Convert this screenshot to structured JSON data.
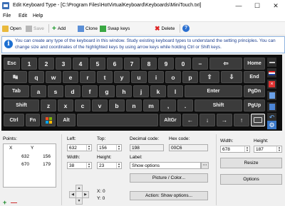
{
  "window": {
    "title": "Edit Keyboard Type - [C:\\Program Files\\HotVirtualKeyboard\\Keyboards\\MiniTouch.txt]"
  },
  "menu": [
    {
      "label": "File"
    },
    {
      "label": "Edit"
    },
    {
      "label": "Help"
    }
  ],
  "toolbar": {
    "open": "Open",
    "save": "Save",
    "add": "Add",
    "clone": "Clone",
    "swap": "Swap keys",
    "delete": "Delete"
  },
  "info": {
    "text": "You can create any type of the keyboard in this window. Study existing keyboard types to understand the setting principles. You can change size and coordinates of the highlighted keys by using arrow keys while holding Ctrl or Shift keys."
  },
  "keyboard": {
    "row1": [
      "Esc",
      "1",
      "2",
      "3",
      "4",
      "5",
      "6",
      "7",
      "8",
      "9",
      "0",
      "−",
      "⇦",
      "Home"
    ],
    "row1_top": [
      "",
      "!",
      "@",
      "#",
      "$",
      "%",
      "^",
      "&",
      "*",
      "(",
      ")",
      "_",
      "",
      ""
    ],
    "row2": [
      "↹",
      "q",
      "w",
      "e",
      "r",
      "t",
      "y",
      "u",
      "i",
      "o",
      "p",
      "⇧",
      "⇩",
      "End"
    ],
    "row3": [
      "Tab",
      "a",
      "s",
      "d",
      "f",
      "g",
      "h",
      "j",
      "k",
      "l",
      "Enter",
      "PgDn"
    ],
    "row4": [
      "Shift",
      "z",
      "x",
      "c",
      "v",
      "b",
      "n",
      "m",
      ",",
      ".",
      "Shift",
      "PgUp"
    ],
    "row5": [
      "Ctrl",
      "Fn",
      "",
      "Alt",
      "AltGr",
      "",
      "",
      "",
      ""
    ]
  },
  "points": {
    "label": "Points:",
    "headers": [
      "X",
      "Y"
    ],
    "rows": [
      [
        "632",
        "156"
      ],
      [
        "670",
        "179"
      ]
    ]
  },
  "fields": {
    "left_label": "Left:",
    "left": "632",
    "top_label": "Top:",
    "top": "156",
    "width_label": "Width:",
    "width": "38",
    "height_label": "Height:",
    "height": "23",
    "decimal_label": "Decimal code:",
    "decimal": "198",
    "hex_label": "Hex code:",
    "hex": "00C6",
    "label_label": "Label:",
    "label": "Show options",
    "picture_btn": "Picture / Color...",
    "action_btn": "Action: Show options...",
    "xcoord": "X: 0",
    "ycoord": "Y: 0"
  },
  "right": {
    "width_label": "Width:",
    "width": "678",
    "height_label": "Height:",
    "height": "187",
    "resize": "Resize",
    "options": "Options"
  }
}
